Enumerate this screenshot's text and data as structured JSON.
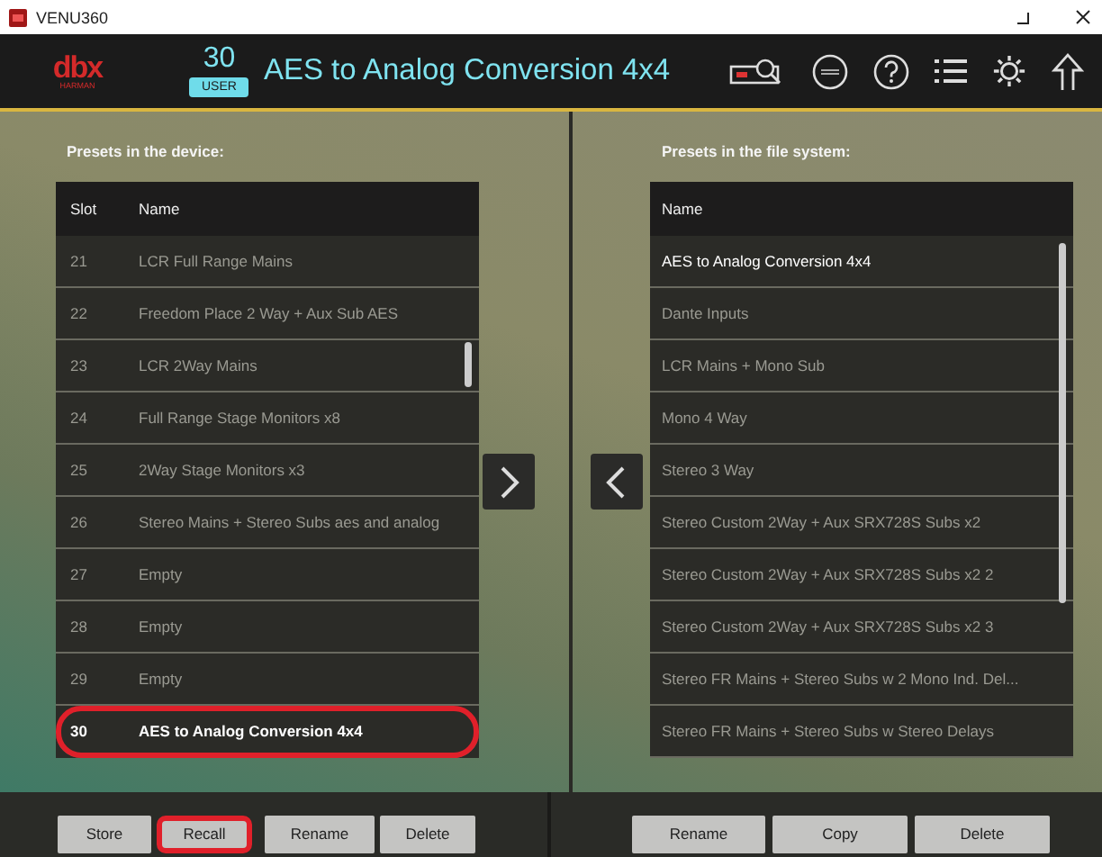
{
  "window": {
    "title": "VENU360"
  },
  "header": {
    "logo": "dbx",
    "logo_sub": "HARMAN",
    "preset_number": "30",
    "preset_bank": "USER",
    "preset_name": "AES to Analog Conversion 4x4"
  },
  "device_panel": {
    "heading": "Presets in the device:",
    "columns": [
      "Slot",
      "Name"
    ],
    "rows": [
      {
        "slot": "21",
        "name": "LCR Full Range Mains",
        "selected": false,
        "highlighted": false
      },
      {
        "slot": "22",
        "name": "Freedom Place 2 Way  + Aux Sub AES",
        "selected": false,
        "highlighted": false
      },
      {
        "slot": "23",
        "name": "LCR 2Way Mains",
        "selected": false,
        "highlighted": false
      },
      {
        "slot": "24",
        "name": "Full Range Stage Monitors x8",
        "selected": false,
        "highlighted": false
      },
      {
        "slot": "25",
        "name": "2Way Stage Monitors x3",
        "selected": false,
        "highlighted": false
      },
      {
        "slot": "26",
        "name": "Stereo Mains + Stereo Subs aes and analog",
        "selected": false,
        "highlighted": false
      },
      {
        "slot": "27",
        "name": "Empty",
        "selected": false,
        "highlighted": false
      },
      {
        "slot": "28",
        "name": "Empty",
        "selected": false,
        "highlighted": false
      },
      {
        "slot": "29",
        "name": "Empty",
        "selected": false,
        "highlighted": false
      },
      {
        "slot": "30",
        "name": "AES to Analog Conversion 4x4",
        "selected": true,
        "highlighted": true
      }
    ]
  },
  "file_panel": {
    "heading": "Presets in the file system:",
    "columns": [
      "Name"
    ],
    "rows": [
      {
        "name": "AES to Analog Conversion 4x4",
        "selected": true
      },
      {
        "name": "Dante Inputs",
        "selected": false
      },
      {
        "name": "LCR Mains + Mono Sub",
        "selected": false
      },
      {
        "name": "Mono 4 Way",
        "selected": false
      },
      {
        "name": "Stereo 3 Way",
        "selected": false
      },
      {
        "name": "Stereo Custom 2Way + Aux SRX728S Subs x2",
        "selected": false
      },
      {
        "name": "Stereo Custom 2Way + Aux SRX728S Subs x2 2",
        "selected": false
      },
      {
        "name": "Stereo Custom 2Way + Aux SRX728S Subs x2 3",
        "selected": false
      },
      {
        "name": "Stereo FR Mains + Stereo Subs w 2 Mono Ind. Del...",
        "selected": false
      },
      {
        "name": "Stereo FR Mains + Stereo Subs w Stereo Delays",
        "selected": false
      }
    ]
  },
  "device_buttons": [
    {
      "label": "Store",
      "highlighted": false
    },
    {
      "label": "Recall",
      "highlighted": true
    },
    {
      "label": "Rename",
      "highlighted": false
    },
    {
      "label": "Delete",
      "highlighted": false
    }
  ],
  "file_buttons": [
    {
      "label": "Rename",
      "highlighted": false
    },
    {
      "label": "Copy",
      "highlighted": false
    },
    {
      "label": "Delete",
      "highlighted": false
    }
  ]
}
